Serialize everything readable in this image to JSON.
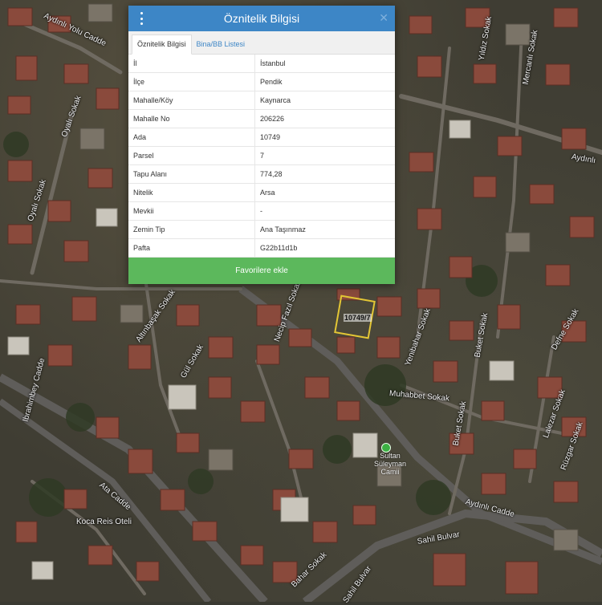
{
  "dialog": {
    "title": "Öznitelik Bilgisi",
    "menu_icon": "kebab-menu-icon",
    "close_symbol": "✕",
    "tabs": [
      {
        "label": "Öznitelik Bilgisi",
        "active": true
      },
      {
        "label": "Bina/BB Listesi",
        "active": false
      }
    ],
    "rows": [
      {
        "key": "İl",
        "value": "İstanbul"
      },
      {
        "key": "İlçe",
        "value": "Pendik"
      },
      {
        "key": "Mahalle/Köy",
        "value": "Kaynarca"
      },
      {
        "key": "Mahalle No",
        "value": "206226"
      },
      {
        "key": "Ada",
        "value": "10749"
      },
      {
        "key": "Parsel",
        "value": "7"
      },
      {
        "key": "Tapu Alanı",
        "value": "774,28"
      },
      {
        "key": "Nitelik",
        "value": "Arsa"
      },
      {
        "key": "Mevkii",
        "value": "-"
      },
      {
        "key": "Zemin Tip",
        "value": "Ana Taşınmaz"
      },
      {
        "key": "Pafta",
        "value": "G22b11d1b"
      }
    ],
    "favorite_label": "Favorilere ekle",
    "colors": {
      "header": "#3d86c6",
      "favorite": "#5cb85c"
    }
  },
  "map": {
    "parcel_label": "10749/7",
    "poi_name": "Sultan Süleyman Camii",
    "streets": [
      "Aydınlı Yolu Cadde",
      "Oyalı Sokak",
      "Oyalı Sokak",
      "Mercanlı Sokak",
      "Yıldız Sokak",
      "Aydınlı",
      "Altınbaşak Sokak",
      "Gül Sokak",
      "Necip Fazıl Sokak",
      "Ibrahimbey Cadde",
      "Ata Cadde",
      "Yenibahar Sokak",
      "Muhabbet Sokak",
      "Buket Sokak",
      "Buket Sokak",
      "Defne Sokak",
      "Lalezar Sokak",
      "Rüzgar Sokak",
      "Sahil Bulvar",
      "Sahil Bulvar",
      "Koca Reis Oteli",
      "Aydınlı Cadde",
      "Bahar Sokak"
    ]
  }
}
